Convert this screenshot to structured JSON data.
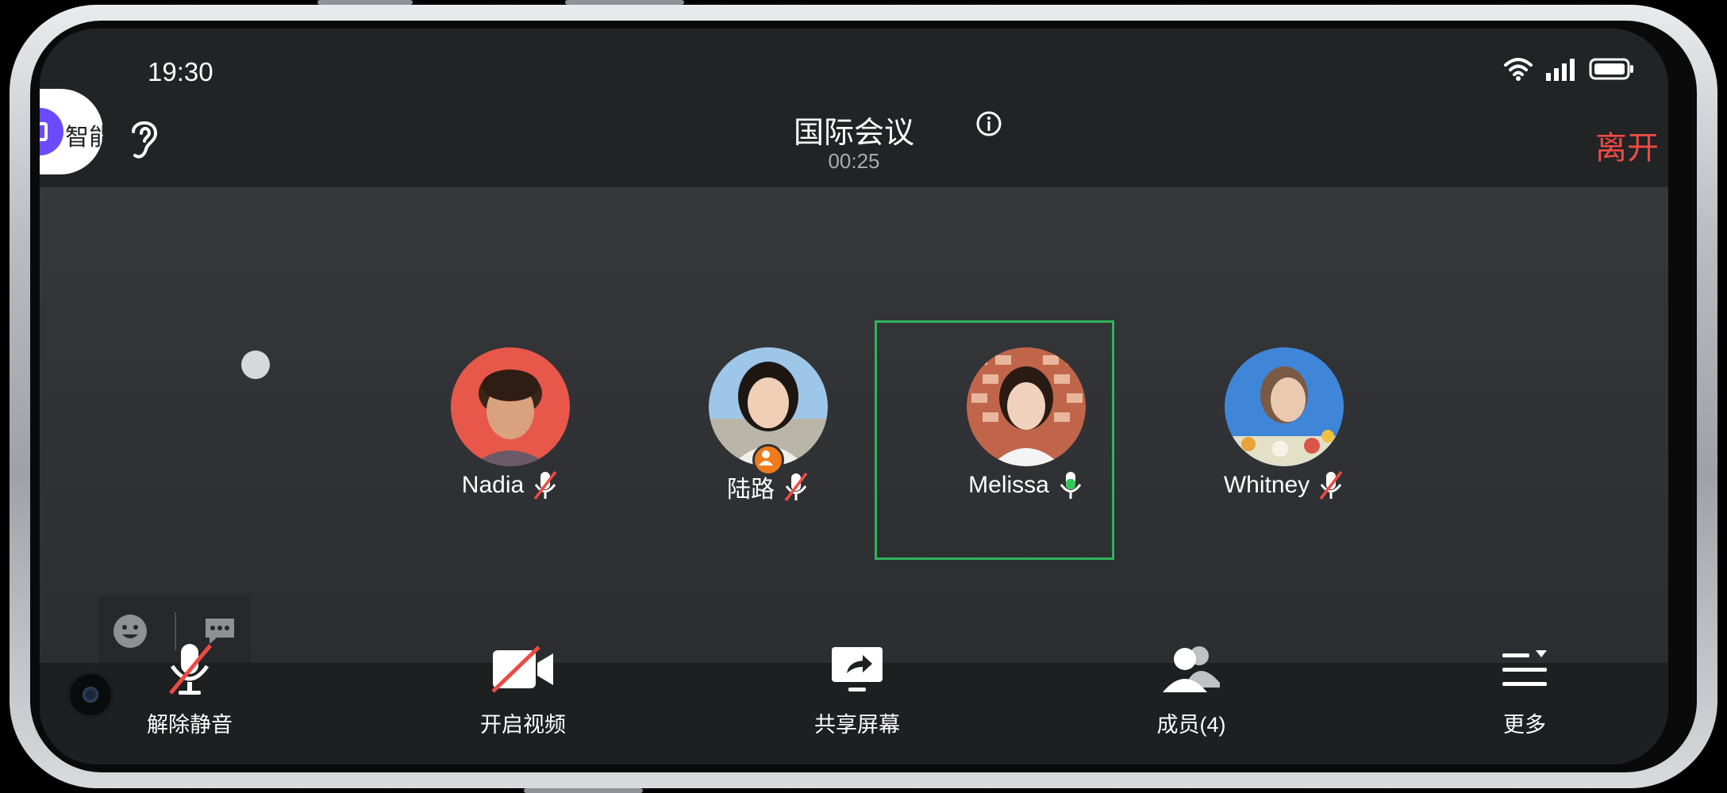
{
  "status_bar": {
    "time": "19:30"
  },
  "header": {
    "ai_assistant_label": "智能",
    "meeting_title": "国际会议",
    "timer": "00:25",
    "leave_label": "离开"
  },
  "participants": [
    {
      "name": "Nadia",
      "muted": true
    },
    {
      "name": "陆路",
      "muted": true,
      "host": true
    },
    {
      "name": "Melissa",
      "muted": false,
      "speaking": true
    },
    {
      "name": "Whitney",
      "muted": true
    }
  ],
  "toolbar": {
    "unmute_label": "解除静音",
    "video_label": "开启视频",
    "share_label": "共享屏幕",
    "members_label": "成员(4)",
    "more_label": "更多"
  },
  "colors": {
    "leave": "#ec4b44",
    "active_speaker": "#2fb35c",
    "mic_active": "#34c759",
    "host_badge": "#f07b1a",
    "ai_accent": "#6b4bff"
  }
}
